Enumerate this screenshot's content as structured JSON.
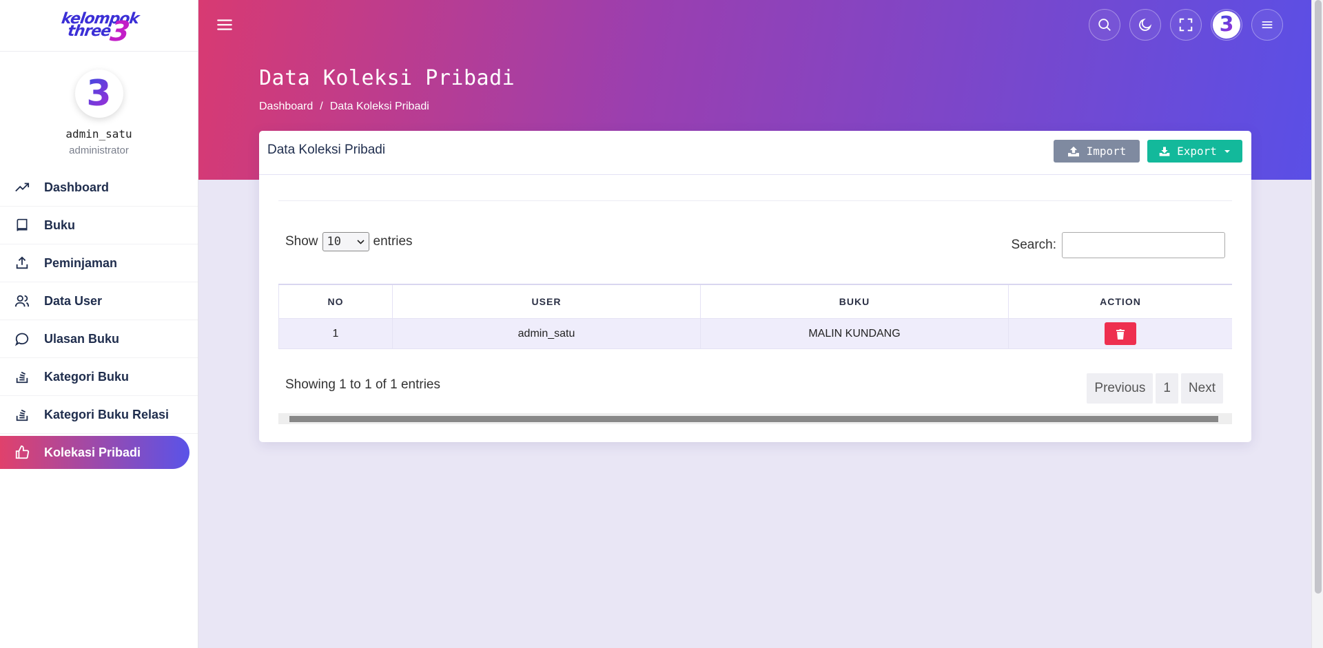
{
  "sidebar": {
    "logo_line1": "kelompok",
    "logo_line2": "three",
    "logo_number": "3",
    "avatar_glyph": "3",
    "user_name": "admin_satu",
    "user_role": "administrator",
    "items": [
      {
        "label": "Dashboard",
        "icon": "trending-up-icon"
      },
      {
        "label": "Buku",
        "icon": "book-icon"
      },
      {
        "label": "Peminjaman",
        "icon": "upload-icon"
      },
      {
        "label": "Data User",
        "icon": "users-icon"
      },
      {
        "label": "Ulasan Buku",
        "icon": "chat-icon"
      },
      {
        "label": "Kategori Buku",
        "icon": "stack-icon"
      },
      {
        "label": "Kategori Buku Relasi",
        "icon": "stack-icon"
      },
      {
        "label": "Kolekasi Pribadi",
        "icon": "thumbs-up-icon"
      }
    ],
    "active_index": 7
  },
  "header": {
    "page_title": "Data Koleksi Pribadi",
    "breadcrumb": [
      "Dashboard",
      "Data Koleksi Pribadi"
    ],
    "breadcrumb_separator": "/"
  },
  "card": {
    "title": "Data Koleksi Pribadi",
    "import_label": "Import",
    "export_label": "Export"
  },
  "table_controls": {
    "show_label": "Show",
    "entries_label": "entries",
    "page_length": "10",
    "search_label": "Search:",
    "search_value": ""
  },
  "table": {
    "columns": [
      "NO",
      "USER",
      "BUKU",
      "ACTION"
    ],
    "rows": [
      {
        "no": "1",
        "user": "admin_satu",
        "buku": "MALIN KUNDANG"
      }
    ]
  },
  "footer": {
    "info": "Showing 1 to 1 of 1 entries",
    "previous": "Previous",
    "page": "1",
    "next": "Next"
  },
  "colors": {
    "gradient_start": "#d83a72",
    "gradient_end": "#5a4fe6",
    "export_button": "#13b99b",
    "import_button": "#7f8aa0",
    "delete_button": "#ee2f4f"
  }
}
